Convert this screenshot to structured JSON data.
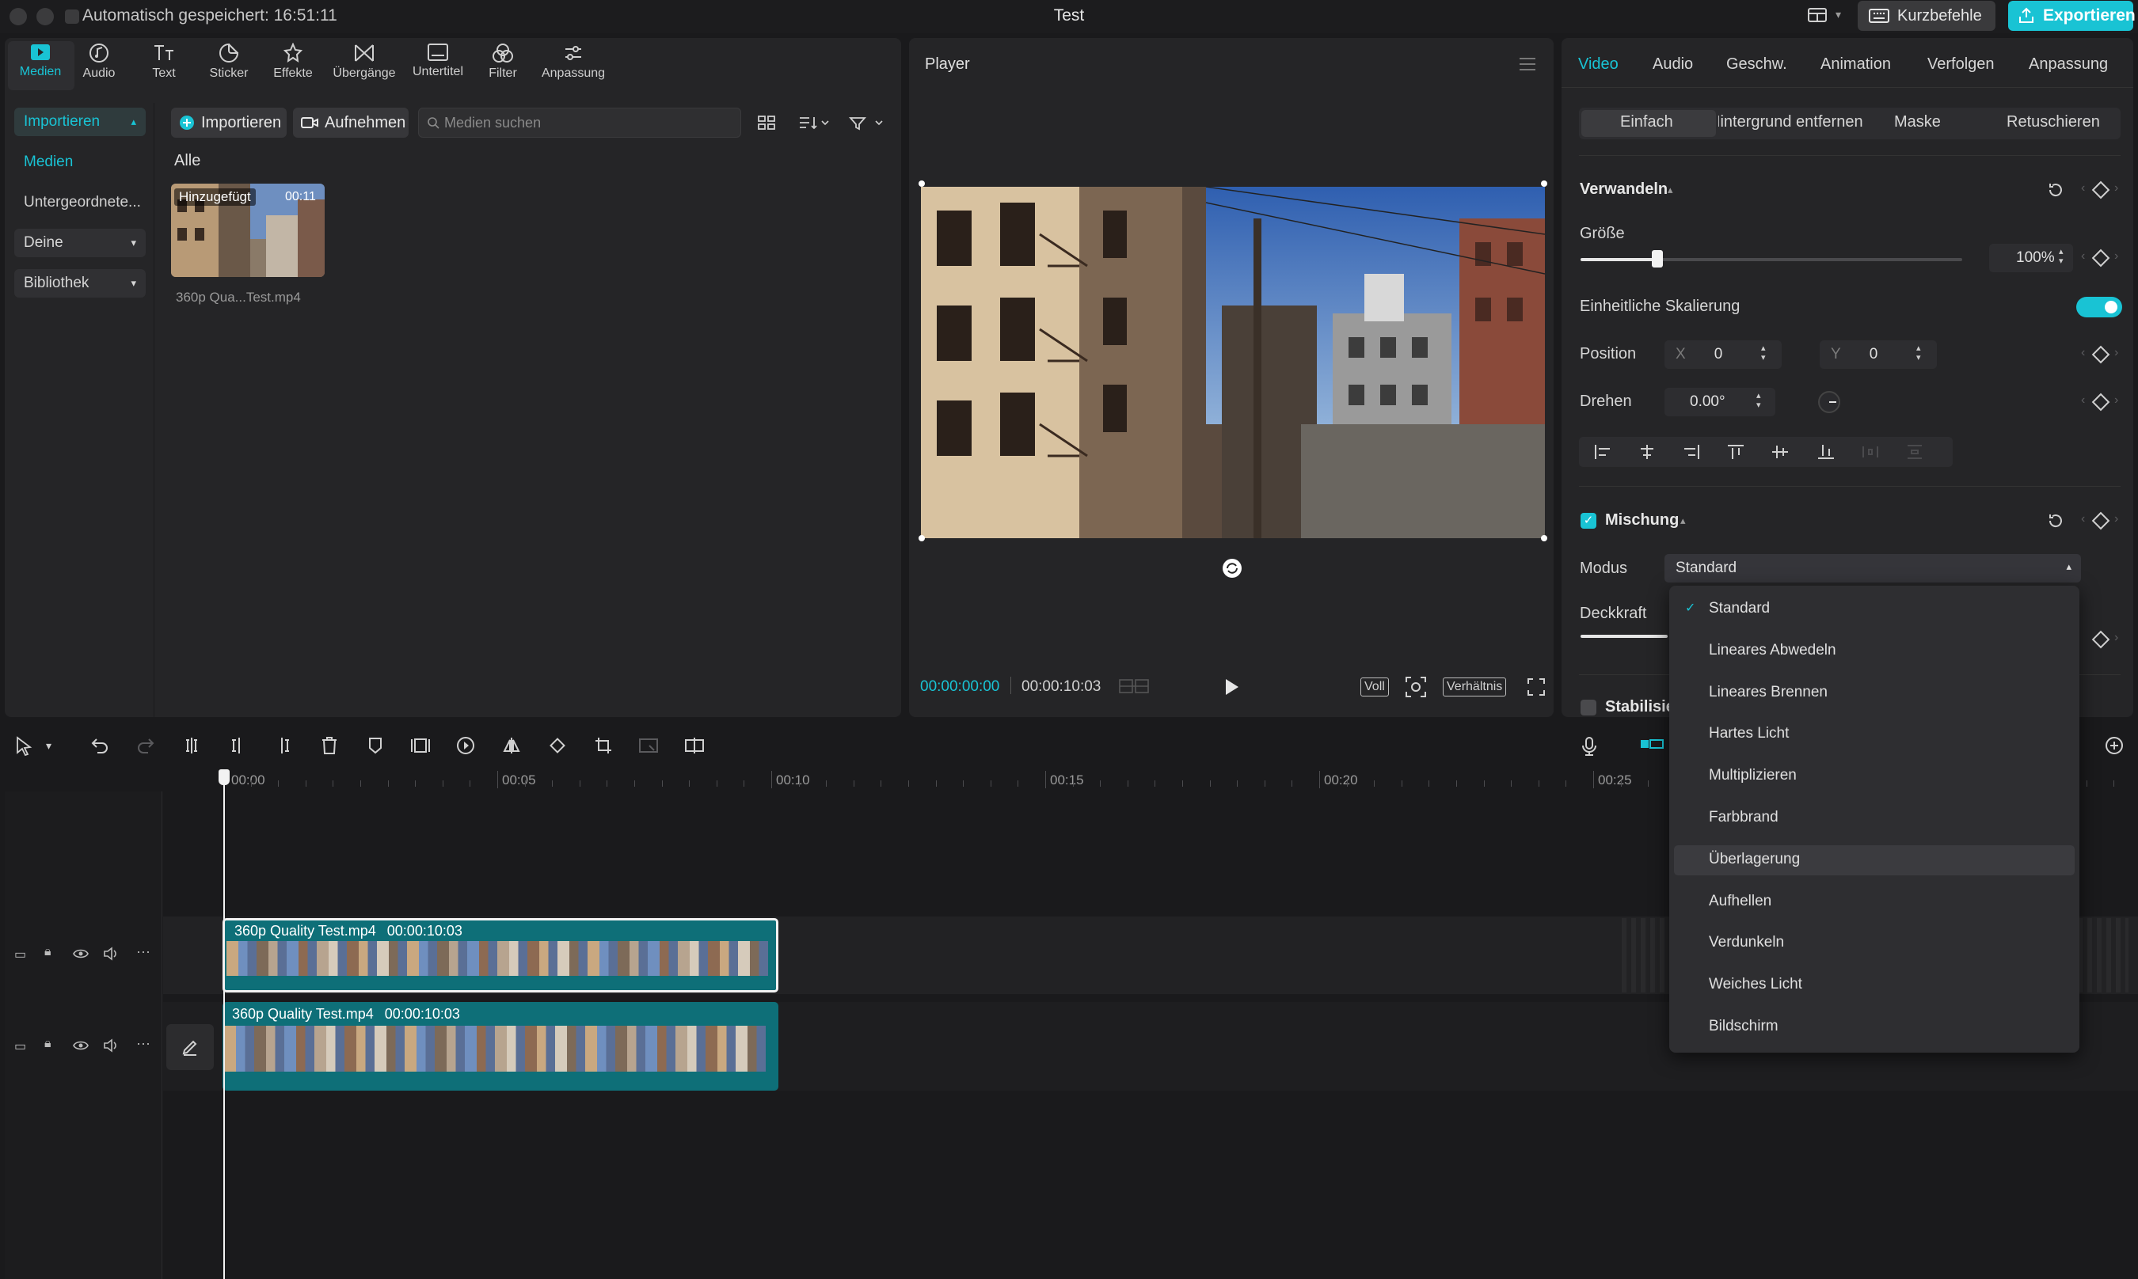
{
  "window": {
    "autosave": "Automatisch gespeichert: 16:51:11",
    "title": "Test",
    "shortcuts_label": "Kurzbefehle",
    "export_label": "Exportieren"
  },
  "media_toolbar": [
    {
      "label": "Medien",
      "icon": "media-icon"
    },
    {
      "label": "Audio",
      "icon": "audio-icon"
    },
    {
      "label": "Text",
      "icon": "text-icon"
    },
    {
      "label": "Sticker",
      "icon": "sticker-icon"
    },
    {
      "label": "Effekte",
      "icon": "effects-icon"
    },
    {
      "label": "Übergänge",
      "icon": "transitions-icon"
    },
    {
      "label": "Untertitel",
      "icon": "subtitles-icon"
    },
    {
      "label": "Filter",
      "icon": "filter-icon"
    },
    {
      "label": "Anpassung",
      "icon": "adjust-icon"
    }
  ],
  "sidebar": {
    "import": "Importieren",
    "media": "Medien",
    "sub": "Untergeordnete...",
    "yours": "Deine",
    "library": "Bibliothek"
  },
  "media": {
    "import_btn": "Importieren",
    "record_btn": "Aufnehmen",
    "search_placeholder": "Medien suchen",
    "filter_all": "Alle",
    "item_badge": "Hinzugefügt",
    "item_duration": "00:11",
    "item_name": "360p Qua...Test.mp4"
  },
  "player": {
    "title": "Player",
    "current_time": "00:00:00:00",
    "total_time": "00:00:10:03",
    "full_label": "Voll",
    "ratio_label": "Verhältnis"
  },
  "props": {
    "tabs": [
      "Video",
      "Audio",
      "Geschw.",
      "Animation",
      "Verfolgen",
      "Anpassung"
    ],
    "subtabs": [
      "Einfach",
      "Hintergrund entfernen",
      "Maske",
      "Retuschieren"
    ],
    "transform_title": "Verwandeln",
    "size_label": "Größe",
    "size_value": "100%",
    "uniform_label": "Einheitliche Skalierung",
    "position_label": "Position",
    "x_label": "X",
    "x_value": "0",
    "y_label": "Y",
    "y_value": "0",
    "rotate_label": "Drehen",
    "rotate_value": "0.00°",
    "blend_title": "Mischung",
    "mode_label": "Modus",
    "mode_value": "Standard",
    "opacity_label": "Deckkraft",
    "stabilize_label": "Stabilisie"
  },
  "blend_modes": [
    "Standard",
    "Lineares Abwedeln",
    "Lineares Brennen",
    "Hartes Licht",
    "Multiplizieren",
    "Farbbrand",
    "Überlagerung",
    "Aufhellen",
    "Verdunkeln",
    "Weiches Licht",
    "Bildschirm"
  ],
  "timeline": {
    "ruler": [
      "00:00",
      "00:05",
      "00:10",
      "00:15",
      "00:20",
      "00:25"
    ],
    "clips": [
      {
        "name": "360p Quality Test.mp4",
        "duration": "00:00:10:03"
      },
      {
        "name": "360p Quality Test.mp4",
        "duration": "00:00:10:03"
      }
    ]
  },
  "colors": {
    "accent": "#19c3d4",
    "clip": "#0e6f78"
  }
}
